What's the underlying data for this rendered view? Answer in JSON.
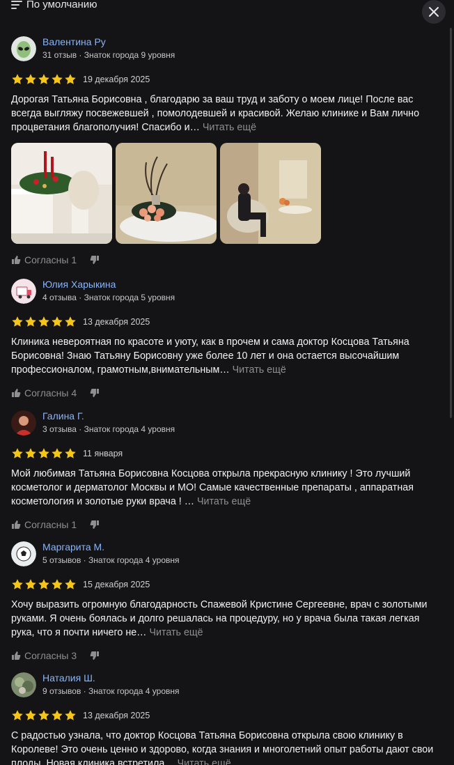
{
  "header": {
    "sort_label": "По умолчанию",
    "sort_icon": "sort-lines-icon",
    "close_icon": "close-icon"
  },
  "colors": {
    "background": "#141416",
    "author_link": "#8ab4f8",
    "star": "#f5c518",
    "muted": "#8e8e93"
  },
  "reviews": [
    {
      "author": "Валентина Ру",
      "meta": "31 отзыв · Знаток города 9 уровня",
      "rating": 5,
      "date": "19 декабря 2025",
      "text": "Дорогая Татьяна Борисовна , благодарю за ваш труд и заботу о моем лице! После вас всегда выгляжу посвежевшей , помолодевшей и красивой. Желаю клинике и Вам лично процветания благополучия! Спасибо и…",
      "read_more": "Читать ещё",
      "agree_label": "Согласны 1",
      "photos": [
        "christmas-arrangement",
        "flowers-on-table",
        "woman-in-chair"
      ]
    },
    {
      "author": "Юлия Харыкина",
      "meta": "4 отзыва · Знаток города 5 уровня",
      "rating": 5,
      "date": "13 декабря 2025",
      "text": "Клиника невероятная по красоте и уюту, как в прочем и сама доктор Косцова Татьяна Борисовна! Знаю Татьяну Борисовну уже более 10 лет и она остается высочайшим профессионалом, грамотным,внимательным…",
      "read_more": "Читать ещё",
      "agree_label": "Согласны 4"
    },
    {
      "author": "Галина Г.",
      "meta": "3 отзыва · Знаток города 4 уровня",
      "rating": 5,
      "date": "11 января",
      "text": "Мой любимая Татьяна Борисовна Косцова открыла прекрасную клинику ! Это лучший косметолог и дерматолог Москвы и МО! Самые качественные препараты , аппаратная косметология и золотые руки врача ! …",
      "read_more": "Читать ещё",
      "agree_label": "Согласны 1"
    },
    {
      "author": "Маргарита М.",
      "meta": "5 отзывов · Знаток города 4 уровня",
      "rating": 5,
      "date": "15 декабря 2025",
      "text": "Хочу выразить огромную благодарность Спажевой Кристине Сергеевне, врач с золотыми руками. Я очень боялась и долго решалась на процедуру, но у врача была такая легкая рука, что я почти ничего не…",
      "read_more": "Читать ещё",
      "agree_label": "Согласны 3"
    },
    {
      "author": "Наталия Ш.",
      "meta": "9 отзывов · Знаток города 4 уровня",
      "rating": 5,
      "date": "13 декабря 2025",
      "text": "С радостью узнала, что доктор Косцова Татьяна Борисовна открыла свою клинику в Королеве! Это очень ценно и здорово, когда знания и многолетний опыт работы дают свои плоды. Новая клиника встретила…",
      "read_more": "Читать ещё",
      "agree_label": ""
    }
  ]
}
